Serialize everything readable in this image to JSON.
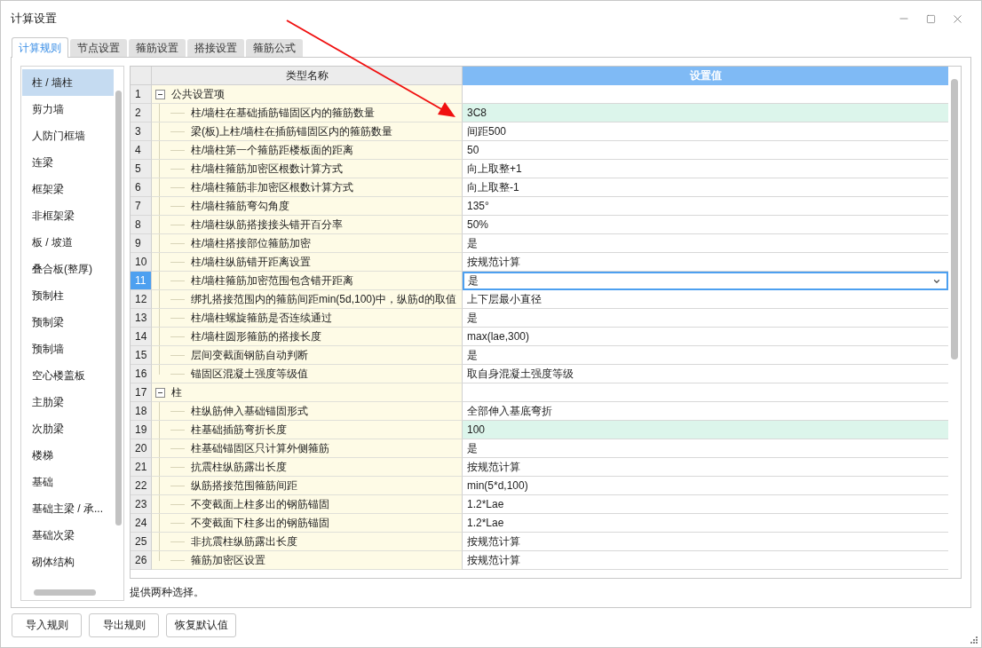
{
  "window": {
    "title": "计算设置"
  },
  "tabs": [
    {
      "label": "计算规则",
      "selected": true
    },
    {
      "label": "节点设置",
      "selected": false
    },
    {
      "label": "箍筋设置",
      "selected": false
    },
    {
      "label": "搭接设置",
      "selected": false
    },
    {
      "label": "箍筋公式",
      "selected": false
    }
  ],
  "sidebar": {
    "items": [
      {
        "label": "柱 / 墙柱",
        "selected": true
      },
      {
        "label": "剪力墙",
        "selected": false
      },
      {
        "label": "人防门框墙",
        "selected": false
      },
      {
        "label": "连梁",
        "selected": false
      },
      {
        "label": "框架梁",
        "selected": false
      },
      {
        "label": "非框架梁",
        "selected": false
      },
      {
        "label": "板 / 坡道",
        "selected": false
      },
      {
        "label": "叠合板(整厚)",
        "selected": false
      },
      {
        "label": "预制柱",
        "selected": false
      },
      {
        "label": "预制梁",
        "selected": false
      },
      {
        "label": "预制墙",
        "selected": false
      },
      {
        "label": "空心楼盖板",
        "selected": false
      },
      {
        "label": "主肋梁",
        "selected": false
      },
      {
        "label": "次肋梁",
        "selected": false
      },
      {
        "label": "楼梯",
        "selected": false
      },
      {
        "label": "基础",
        "selected": false
      },
      {
        "label": "基础主梁 / 承...",
        "selected": false
      },
      {
        "label": "基础次梁",
        "selected": false
      },
      {
        "label": "砌体结构",
        "selected": false
      }
    ]
  },
  "table": {
    "columns": [
      "类型名称",
      "设置值"
    ],
    "rows": [
      {
        "num": "1",
        "name": "公共设置项",
        "expanded": true,
        "children": [
          {
            "num": "2",
            "name": "柱/墙柱在基础插筋锚固区内的箍筋数量",
            "value": "3C8",
            "highlighted": true,
            "selected": false
          },
          {
            "num": "3",
            "name": "梁(板)上柱/墙柱在插筋锚固区内的箍筋数量",
            "value": "间距500",
            "highlighted": false,
            "selected": false
          },
          {
            "num": "4",
            "name": "柱/墙柱第一个箍筋距楼板面的距离",
            "value": "50",
            "highlighted": false,
            "selected": false
          },
          {
            "num": "5",
            "name": "柱/墙柱箍筋加密区根数计算方式",
            "value": "向上取整+1",
            "highlighted": false,
            "selected": false
          },
          {
            "num": "6",
            "name": "柱/墙柱箍筋非加密区根数计算方式",
            "value": "向上取整-1",
            "highlighted": false,
            "selected": false
          },
          {
            "num": "7",
            "name": "柱/墙柱箍筋弯勾角度",
            "value": "135°",
            "highlighted": false,
            "selected": false
          },
          {
            "num": "8",
            "name": "柱/墙柱纵筋搭接接头错开百分率",
            "value": "50%",
            "highlighted": false,
            "selected": false
          },
          {
            "num": "9",
            "name": "柱/墙柱搭接部位箍筋加密",
            "value": "是",
            "highlighted": false,
            "selected": false
          },
          {
            "num": "10",
            "name": "柱/墙柱纵筋错开距离设置",
            "value": "按规范计算",
            "highlighted": false,
            "selected": false
          },
          {
            "num": "11",
            "name": "柱/墙柱箍筋加密范围包含错开距离",
            "value": "是",
            "highlighted": false,
            "selected": true
          },
          {
            "num": "12",
            "name": "绑扎搭接范围内的箍筋间距min(5d,100)中，纵筋d的取值",
            "value": "上下层最小直径",
            "highlighted": false,
            "selected": false
          },
          {
            "num": "13",
            "name": "柱/墙柱螺旋箍筋是否连续通过",
            "value": "是",
            "highlighted": false,
            "selected": false
          },
          {
            "num": "14",
            "name": "柱/墙柱圆形箍筋的搭接长度",
            "value": "max(lae,300)",
            "highlighted": false,
            "selected": false
          },
          {
            "num": "15",
            "name": "层间变截面钢筋自动判断",
            "value": "是",
            "highlighted": false,
            "selected": false
          },
          {
            "num": "16",
            "name": "锚固区混凝土强度等级值",
            "value": "取自身混凝土强度等级",
            "highlighted": false,
            "selected": false
          }
        ]
      },
      {
        "num": "17",
        "name": "柱",
        "expanded": true,
        "children": [
          {
            "num": "18",
            "name": "柱纵筋伸入基础锚固形式",
            "value": "全部伸入基底弯折",
            "highlighted": false,
            "selected": false
          },
          {
            "num": "19",
            "name": "柱基础插筋弯折长度",
            "value": "100",
            "highlighted": true,
            "selected": false
          },
          {
            "num": "20",
            "name": "柱基础锚固区只计算外侧箍筋",
            "value": "是",
            "highlighted": false,
            "selected": false
          },
          {
            "num": "21",
            "name": "抗震柱纵筋露出长度",
            "value": "按规范计算",
            "highlighted": false,
            "selected": false
          },
          {
            "num": "22",
            "name": "纵筋搭接范围箍筋间距",
            "value": "min(5*d,100)",
            "highlighted": false,
            "selected": false
          },
          {
            "num": "23",
            "name": "不变截面上柱多出的钢筋锚固",
            "value": "1.2*Lae",
            "highlighted": false,
            "selected": false
          },
          {
            "num": "24",
            "name": "不变截面下柱多出的钢筋锚固",
            "value": "1.2*Lae",
            "highlighted": false,
            "selected": false
          },
          {
            "num": "25",
            "name": "非抗震柱纵筋露出长度",
            "value": "按规范计算",
            "highlighted": false,
            "selected": false
          },
          {
            "num": "26",
            "name": "箍筋加密区设置",
            "value": "按规范计算",
            "highlighted": false,
            "selected": false
          }
        ]
      }
    ]
  },
  "description": "提供两种选择。",
  "buttons": [
    "导入规则",
    "导出规则",
    "恢复默认值"
  ]
}
